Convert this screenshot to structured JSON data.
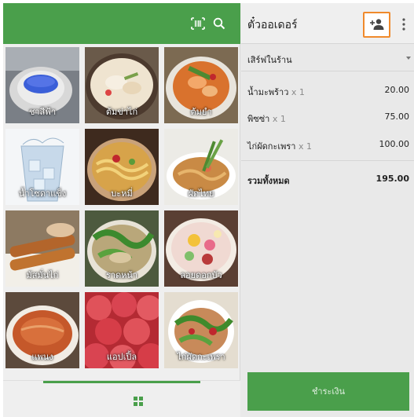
{
  "toolbar": {
    "barcode_icon": "barcode-icon",
    "search_icon": "search-icon",
    "accent_color": "#4a9f4b"
  },
  "menu": {
    "items": [
      {
        "label": "ชาสีฟ้า"
      },
      {
        "label": "ต้มข่าไก่"
      },
      {
        "label": "ต้มยำ"
      },
      {
        "label": "น้ำโซดาแข็ง"
      },
      {
        "label": "บะหมี่"
      },
      {
        "label": "ผัดไทย"
      },
      {
        "label": "มัสมั่นไก่"
      },
      {
        "label": "ราดหน้า"
      },
      {
        "label": "ลอยดอกบัว"
      },
      {
        "label": "แพนง"
      },
      {
        "label": "แอปเปิ้ล"
      },
      {
        "label": "ไก่ผัดกะเพรา"
      }
    ]
  },
  "bottom_nav": {
    "grid_icon": "grid-icon"
  },
  "order": {
    "title": "ตั๋วออเดอร์",
    "add_customer_icon": "add-person-icon",
    "more_icon": "more-vert-icon",
    "service_type": "เสิร์ฟในร้าน",
    "lines": [
      {
        "name": "น้ำมะพร้าว",
        "qty": "x 1",
        "price": "20.00"
      },
      {
        "name": "พิซซ่า",
        "qty": "x 1",
        "price": "75.00"
      },
      {
        "name": "ไก่ผัดกะเพรา",
        "qty": "x 1",
        "price": "100.00"
      }
    ],
    "total_label": "รวมทั้งหมด",
    "total_value": "195.00",
    "pay_label": "ชำระเงิน",
    "highlight_color": "#f08a2c"
  }
}
